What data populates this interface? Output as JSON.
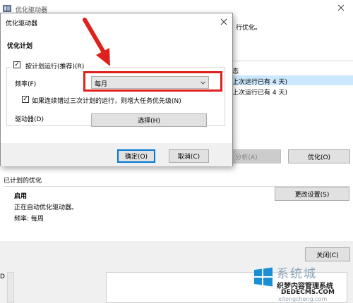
{
  "bg_window": {
    "title": "优化驱动器",
    "header_desc_tail": "行优化。",
    "drive_list": {
      "col_header": "态",
      "rows": [
        "上次运行已有 4 天)",
        "上次运行已有 4 天)"
      ]
    },
    "analyze_button": "分析(A)",
    "optimize_button": "优化(O)",
    "scheduled_section_title": "已计划的优化",
    "status_label": "启用",
    "status_desc": "正在自动优化驱动器。",
    "frequency_text": "频率: 每周",
    "change_settings_button": "更改设置(S)",
    "close_button": "关闭(C)",
    "lower_left_fragment": "D ("
  },
  "dialog": {
    "title": "优化驱动器",
    "section_title": "优化计划",
    "run_on_schedule_label": "按计划运行(推荐)(R)",
    "run_on_schedule_checked": true,
    "frequency_label": "频率(F)",
    "frequency_value": "每月",
    "increase_priority_label": "如果连续错过三次计划的运行，则增大任务优先级(N)",
    "increase_priority_checked": true,
    "drives_label": "驱动器(D)",
    "choose_button": "选择(H)",
    "ok_button": "确定(O)",
    "cancel_button": "取消(C)"
  },
  "annotation": {
    "highlight_color": "#e0201c"
  },
  "watermark": {
    "brand": "系统城",
    "line1": "织梦内容管理系统",
    "line2": "DEDECMS.COM",
    "line3": "xitongcheng.com"
  }
}
